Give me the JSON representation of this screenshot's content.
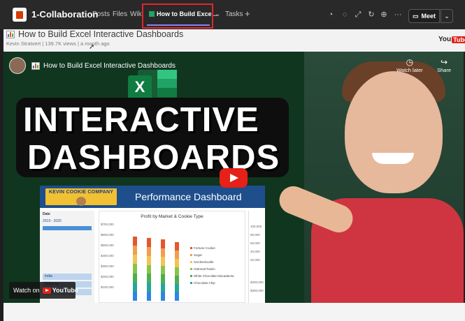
{
  "teams": {
    "channel": "1-Collaboration",
    "tabs": [
      "Posts",
      "Files",
      "Wiki"
    ],
    "active_tab": "How to Build Exce...",
    "tab_after": "Tasks",
    "add_tab": "+",
    "meet_label": "Meet",
    "more": "···"
  },
  "youtube": {
    "title": "How to Build Excel Interactive Dashboards",
    "meta": "Kevin Stratvert | 139.7K views | a month ago",
    "logo_you": "You",
    "logo_tube": "Tube"
  },
  "video": {
    "header_title": "How to Build Excel Interactive Dashboards",
    "watch_later": "Watch later",
    "share": "Share",
    "headline_line1": "INTERACTIVE",
    "headline_line2": "DASHBOARDS",
    "excel_letter": "X",
    "watch_on": "Watch on",
    "watch_on_brand": "YouTube"
  },
  "dashboard": {
    "brand": "KEVIN COOKIE COMPANY",
    "title": "Performance Dashboard",
    "filter_label": "Date",
    "date_range": "2019 - 2020",
    "markets": [
      "India",
      "Malaysia",
      "Philippines"
    ],
    "chart_title": "Profit by Market & Cookie Type",
    "y_ticks": [
      "$700,000",
      "$600,000",
      "$500,000",
      "$400,000",
      "$300,000",
      "$200,000",
      "$100,000"
    ],
    "legend": [
      "Fortune Cookie",
      "Sugar",
      "Snickerdoodle",
      "Oatmeal Raisin",
      "White Chocolate Macadamia",
      "Chocolate Chip"
    ],
    "right_ticks": [
      "100,000",
      "80,000",
      "60,000",
      "40,000",
      "20,000",
      "$400,000",
      "$300,000"
    ]
  },
  "colors": {
    "teams_bar": "#292929",
    "highlight": "#e2262a",
    "youtube_red": "#e62117",
    "excel_green": "#107c41",
    "dash_blue": "#1e4e8c"
  }
}
